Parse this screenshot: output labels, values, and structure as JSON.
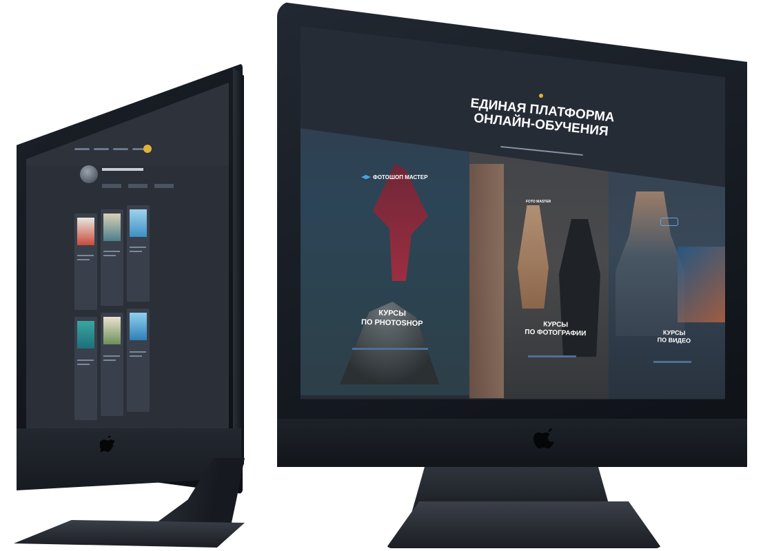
{
  "main_screen": {
    "title_line1": "ЕДИНАЯ ПЛАТФОРМА",
    "title_line2": "ОНЛАЙН-ОБУЧЕНИЯ",
    "panels": [
      {
        "brand": "ФОТОШОП МАСТЕР",
        "label_line1": "КУРСЫ",
        "label_line2": "ПО PHOTOSHOP"
      },
      {
        "brand": "FOTO MASTER",
        "label_line1": "КУРСЫ",
        "label_line2": "ПО ФОТОГРАФИИ"
      },
      {
        "brand": "",
        "label_line1": "КУРСЫ",
        "label_line2": "ПО ВИДЕО"
      }
    ]
  },
  "colors": {
    "bezel": "#151a21",
    "screen_bg": "#262c36",
    "accent_gold": "#e0b13b",
    "link_blue": "#6e9ed8"
  },
  "icons": [
    "apple-logo-icon",
    "graduation-cap-icon"
  ]
}
